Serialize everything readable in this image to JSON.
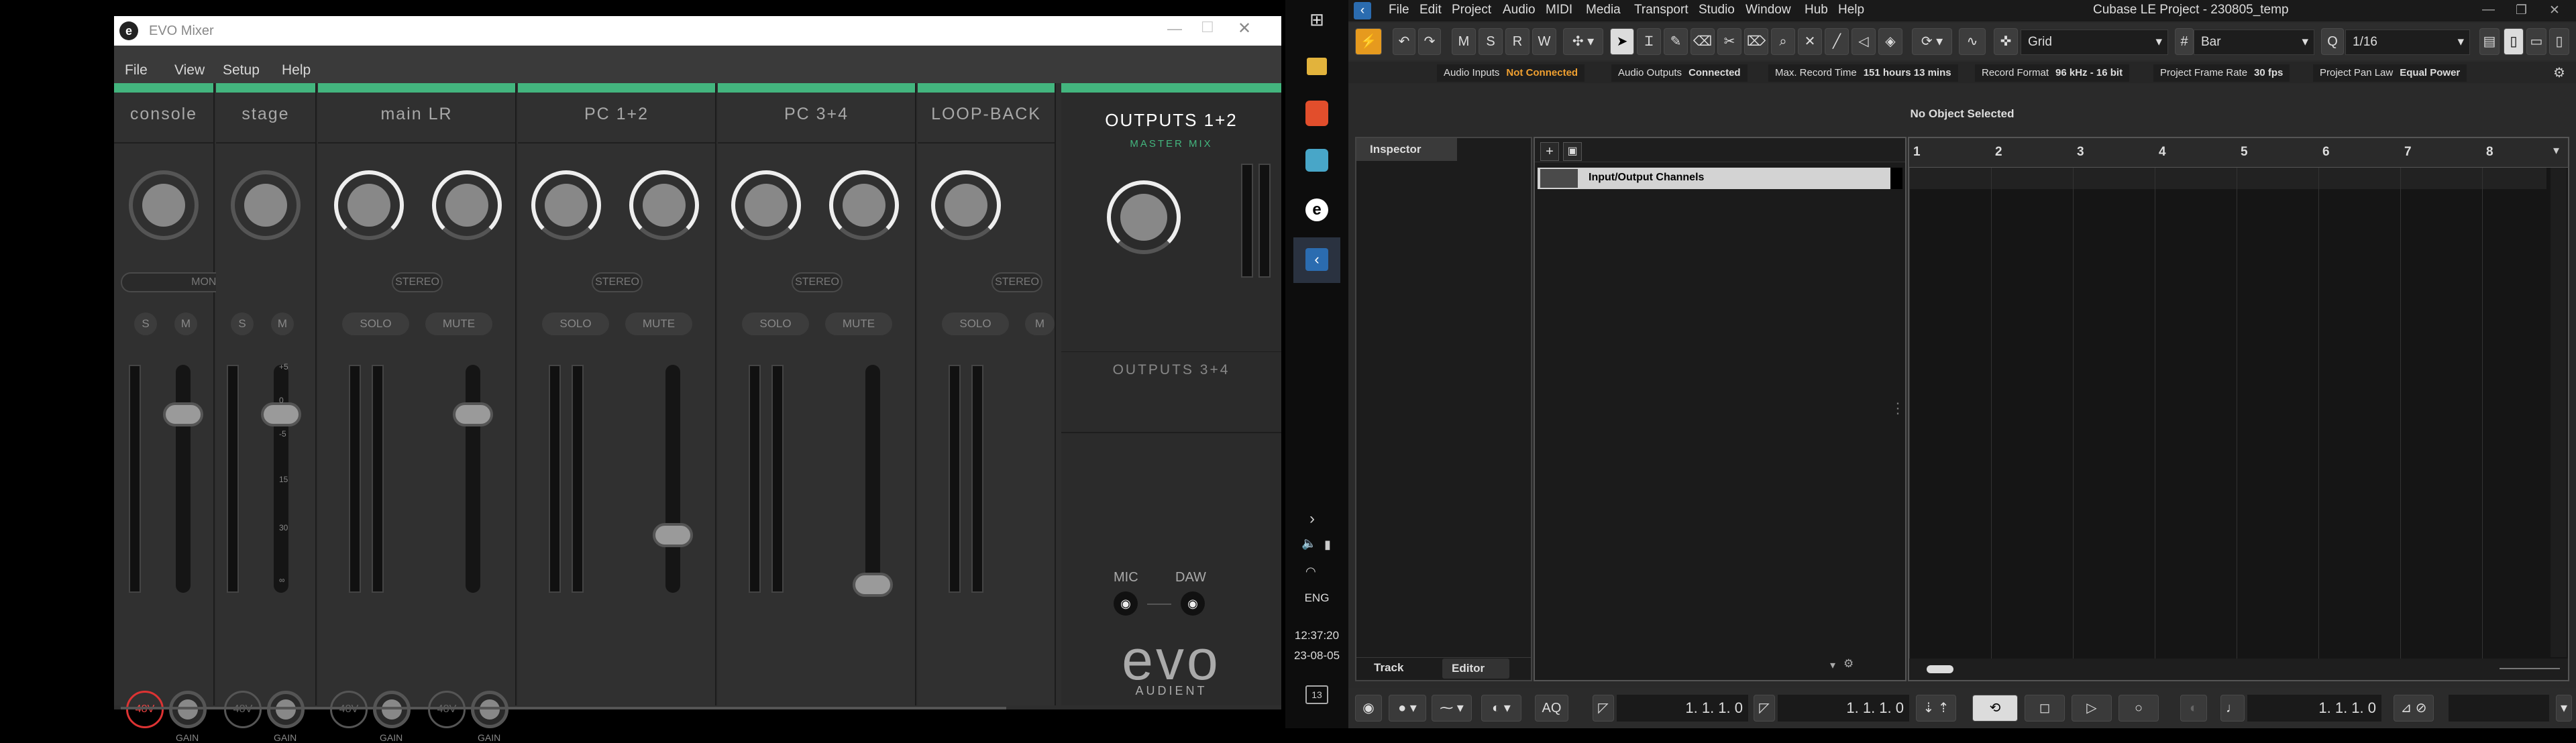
{
  "evo": {
    "title": "EVO Mixer",
    "logo": "e-circle-logo",
    "menu": [
      "File",
      "View",
      "Setup",
      "Help"
    ],
    "channels": [
      {
        "name": "console",
        "mode": "MONO",
        "b1": "S",
        "b2": "M",
        "p48": "48V",
        "p48_on": true,
        "gain": "GAIN"
      },
      {
        "name": "stage",
        "b1": "S",
        "b2": "M",
        "p48": "48V",
        "p48_on": false,
        "gain": "GAIN"
      },
      {
        "name": "main LR",
        "mode": "STEREO",
        "b1": "SOLO",
        "b2": "MUTE",
        "p48a": "48V",
        "p48b": "48V",
        "gain": "GAIN"
      },
      {
        "name": "PC 1+2",
        "mode": "STEREO",
        "b1": "SOLO",
        "b2": "MUTE"
      },
      {
        "name": "PC 3+4",
        "mode": "STEREO",
        "b1": "SOLO",
        "b2": "MUTE"
      },
      {
        "name": "LOOP-BACK",
        "mode": "STEREO",
        "b1": "SOLO",
        "b2": "M"
      }
    ],
    "scale": [
      "+5",
      "0",
      "-5",
      "15",
      "30",
      "∞"
    ],
    "outputs12": "OUTPUTS 1+2",
    "master_mix": "MASTER MIX",
    "outputs34": "OUTPUTS 3+4",
    "mic": "MIC",
    "daw": "DAW",
    "brand": "evo",
    "brand_sub": "AUDIENT"
  },
  "taskbar": {
    "lang": "ENG",
    "time": "12:37:20",
    "date": "23-08-05",
    "notif": "13"
  },
  "cubase": {
    "title": "Cubase LE Project - 230805_temp",
    "menu": [
      "File",
      "Edit",
      "Project",
      "Audio",
      "MIDI",
      "Media",
      "Transport",
      "Studio",
      "Window",
      "Hub",
      "Help"
    ],
    "mode_buttons": [
      "M",
      "S",
      "R",
      "W"
    ],
    "snap": "Grid",
    "grid": "Bar",
    "quantize": "1/16",
    "status": [
      {
        "label": "Audio Inputs",
        "value": "Not Connected",
        "color": "#f0a030"
      },
      {
        "label": "Audio Outputs",
        "value": "Connected",
        "color": "#ffffff"
      },
      {
        "label": "Max. Record Time",
        "value": "151 hours 13 mins",
        "color": "#ffffff"
      },
      {
        "label": "Record Format",
        "value": "96 kHz - 16 bit",
        "color": "#ffffff"
      },
      {
        "label": "Project Frame Rate",
        "value": "30 fps",
        "color": "#ffffff"
      },
      {
        "label": "Project Pan Law",
        "value": "Equal Power",
        "color": "#ffffff"
      }
    ],
    "info": "No Object Selected",
    "inspector_tab": "Inspector",
    "track_tab": "Track",
    "editor_tab": "Editor",
    "folder_track": "Input/Output Channels",
    "ruler": [
      "1",
      "2",
      "3",
      "4",
      "5",
      "6",
      "7",
      "8"
    ],
    "pos1": "1. 1. 1.  0",
    "pos2": "1. 1. 1.  0",
    "pos3": "1. 1. 1.  0",
    "aq": "AQ"
  }
}
